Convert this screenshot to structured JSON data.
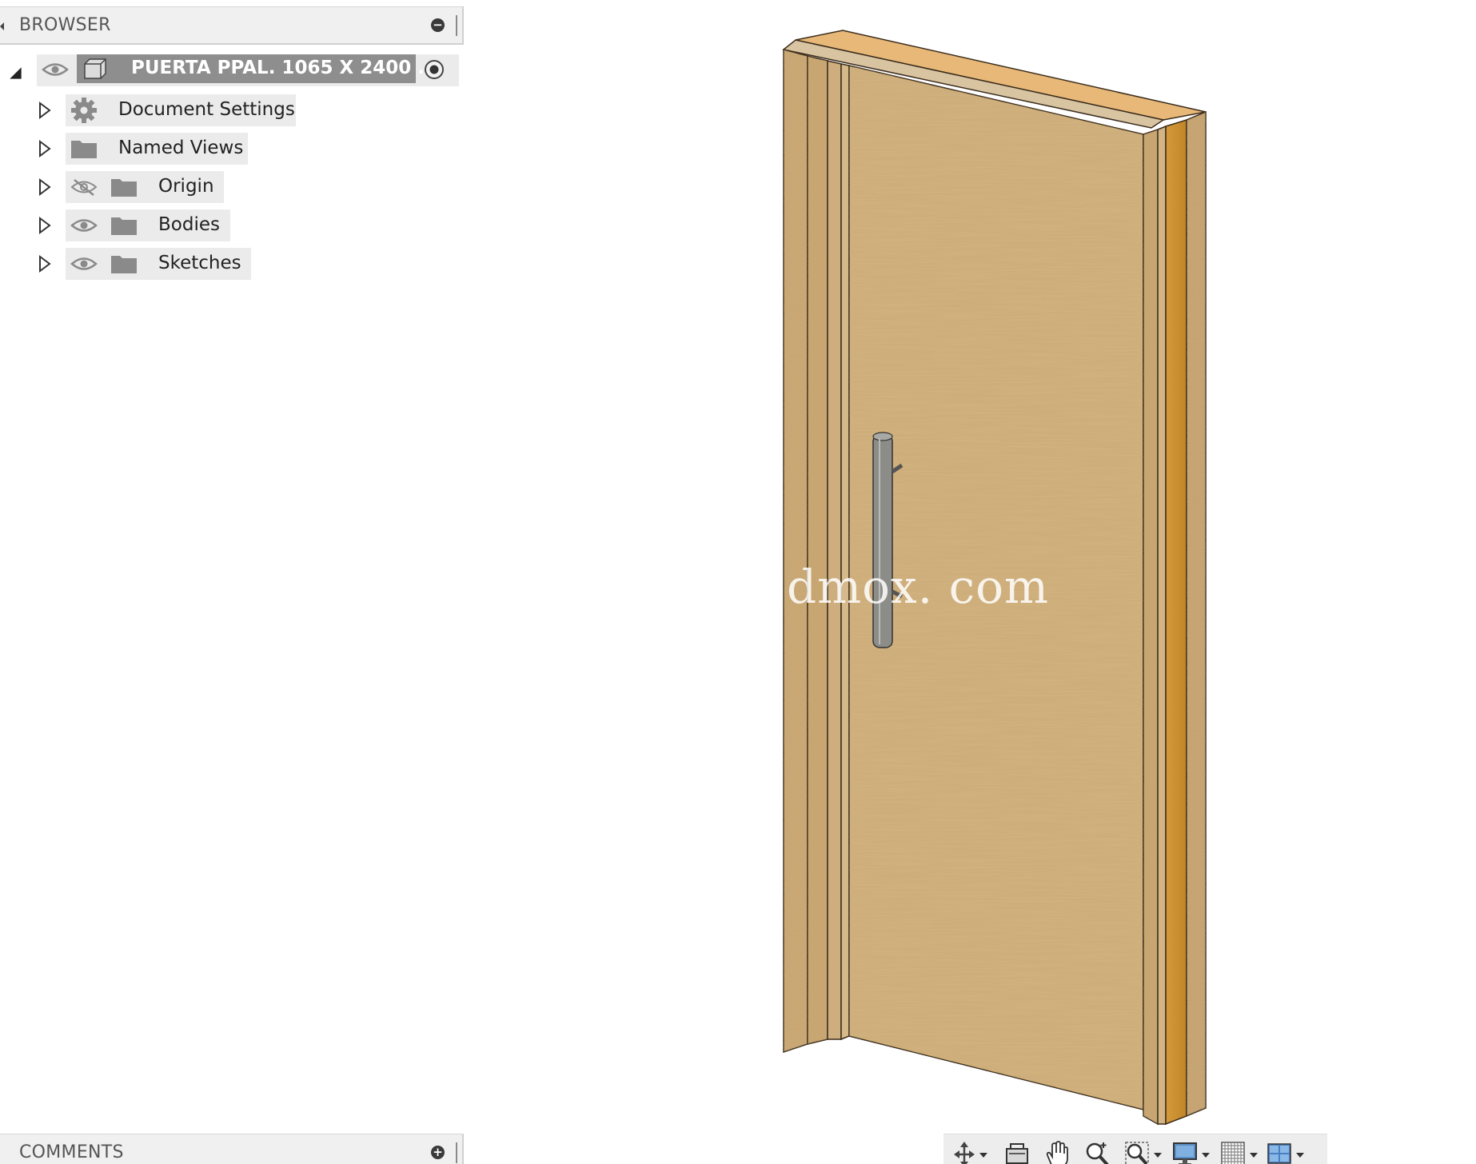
{
  "browser": {
    "title": "BROWSER",
    "root": {
      "label": "PUERTA PPAL. 1065 X 2400 ..."
    },
    "items": [
      {
        "label": "Document Settings",
        "icon": "gear-icon"
      },
      {
        "label": "Named Views",
        "icon": "folder-icon"
      },
      {
        "label": "Origin",
        "icon": "folder-icon",
        "visibility": "hidden"
      },
      {
        "label": "Bodies",
        "icon": "folder-icon",
        "visibility": "visible"
      },
      {
        "label": "Sketches",
        "icon": "folder-icon",
        "visibility": "visible"
      }
    ]
  },
  "viewport": {
    "watermark": "dmox. com"
  },
  "comments": {
    "title": "COMMENTS"
  },
  "toolbar": {
    "tools": [
      "orbit-icon",
      "look-at-icon",
      "pan-icon",
      "zoom-icon",
      "fit-icon",
      "display-settings-icon",
      "grid-settings-icon",
      "viewports-icon"
    ]
  }
}
